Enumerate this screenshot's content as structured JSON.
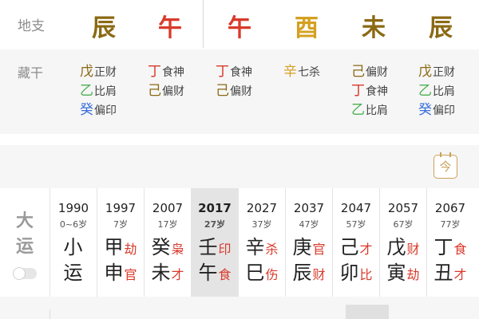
{
  "colors": {
    "wood": "#4caf50",
    "fire": "#d93a2b",
    "earth": "#8b6914",
    "metal": "#d4a020",
    "water": "#3a6fd8",
    "label": "#8c8c8c"
  },
  "dizhi": {
    "label": "地支",
    "branches": [
      {
        "char": "辰",
        "color": "#8b6914"
      },
      {
        "char": "午",
        "color": "#d93a2b"
      },
      {
        "char": "午",
        "color": "#d93a2b"
      },
      {
        "char": "酉",
        "color": "#d4a020"
      },
      {
        "char": "未",
        "color": "#8b6914"
      },
      {
        "char": "辰",
        "color": "#8b6914"
      }
    ]
  },
  "canggan": {
    "label": "藏干",
    "columns": [
      [
        {
          "stem": "戊",
          "god": "正财",
          "color": "#8b6914"
        },
        {
          "stem": "乙",
          "god": "比肩",
          "color": "#4caf50"
        },
        {
          "stem": "癸",
          "god": "偏印",
          "color": "#3a6fd8"
        }
      ],
      [
        {
          "stem": "丁",
          "god": "食神",
          "color": "#d93a2b"
        },
        {
          "stem": "己",
          "god": "偏财",
          "color": "#8b6914"
        }
      ],
      [
        {
          "stem": "丁",
          "god": "食神",
          "color": "#d93a2b"
        },
        {
          "stem": "己",
          "god": "偏财",
          "color": "#8b6914"
        }
      ],
      [
        {
          "stem": "辛",
          "god": "七杀",
          "color": "#d4a020"
        }
      ],
      [
        {
          "stem": "己",
          "god": "偏财",
          "color": "#8b6914"
        },
        {
          "stem": "丁",
          "god": "食神",
          "color": "#d93a2b"
        },
        {
          "stem": "乙",
          "god": "比肩",
          "color": "#4caf50"
        }
      ],
      [
        {
          "stem": "戊",
          "god": "正财",
          "color": "#8b6914"
        },
        {
          "stem": "乙",
          "god": "比肩",
          "color": "#4caf50"
        },
        {
          "stem": "癸",
          "god": "偏印",
          "color": "#3a6fd8"
        }
      ]
    ]
  },
  "calendar_button": {
    "glyph": "今"
  },
  "dayun": {
    "label_top": "大",
    "label_bottom": "运",
    "toggle_on": false,
    "active_index": 3,
    "columns": [
      {
        "year": "1990",
        "age": "0~6岁",
        "top": {
          "char": "小",
          "god": ""
        },
        "bottom": {
          "char": "运",
          "god": ""
        }
      },
      {
        "year": "1997",
        "age": "7岁",
        "top": {
          "char": "甲",
          "god": "劫"
        },
        "bottom": {
          "char": "申",
          "god": "官"
        }
      },
      {
        "year": "2007",
        "age": "17岁",
        "top": {
          "char": "癸",
          "god": "枭"
        },
        "bottom": {
          "char": "未",
          "god": "才"
        }
      },
      {
        "year": "2017",
        "age": "27岁",
        "top": {
          "char": "壬",
          "god": "印"
        },
        "bottom": {
          "char": "午",
          "god": "食"
        }
      },
      {
        "year": "2027",
        "age": "37岁",
        "top": {
          "char": "辛",
          "god": "杀"
        },
        "bottom": {
          "char": "巳",
          "god": "伤"
        }
      },
      {
        "year": "2037",
        "age": "47岁",
        "top": {
          "char": "庚",
          "god": "官"
        },
        "bottom": {
          "char": "辰",
          "god": "财"
        }
      },
      {
        "year": "2047",
        "age": "57岁",
        "top": {
          "char": "己",
          "god": "才"
        },
        "bottom": {
          "char": "卯",
          "god": "比"
        }
      },
      {
        "year": "2057",
        "age": "67岁",
        "top": {
          "char": "戊",
          "god": "财"
        },
        "bottom": {
          "char": "寅",
          "god": "劫"
        }
      },
      {
        "year": "2067",
        "age": "77岁",
        "top": {
          "char": "丁",
          "god": "食"
        },
        "bottom": {
          "char": "丑",
          "god": "才"
        }
      }
    ]
  }
}
